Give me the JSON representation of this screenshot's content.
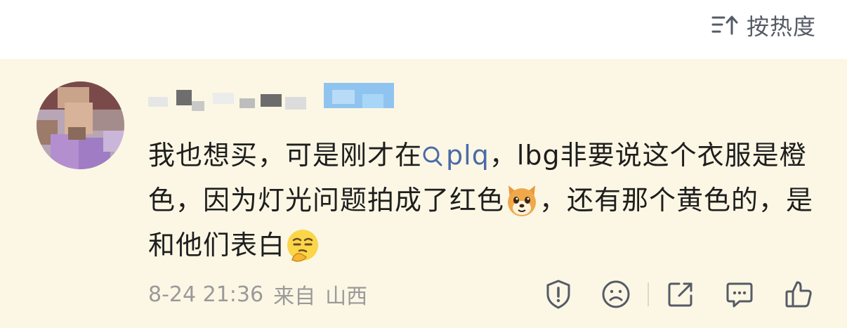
{
  "header": {
    "sort_label": "按热度",
    "sort_icon": "sort-icon"
  },
  "comment": {
    "avatar_icon": "avatar",
    "text_part1": "我也想买，可是刚才在",
    "topic_text": "plq",
    "text_part2": "，lbg非要说这个衣服是橙色，因为灯光问题拍成了红色",
    "emoji1": "dog-emoji",
    "text_part3": "，还有那个黄色的，是和他们表白",
    "emoji2": "thinking-emoji",
    "date": "8-24 21:36",
    "from_label": "来自",
    "location": "山西"
  },
  "actions": {
    "report_icon": "report-icon",
    "dislike_icon": "frown-icon",
    "share_icon": "share-icon",
    "reply_icon": "comment-icon",
    "like_icon": "thumbs-up-icon"
  },
  "colors": {
    "comment_bg": "#fcf7e4",
    "link": "#4a6aa8",
    "meta": "#9a9a9a",
    "icon": "#555b66"
  }
}
